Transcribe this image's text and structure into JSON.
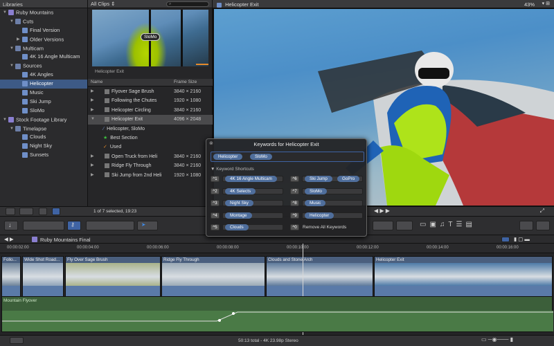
{
  "library": {
    "header": "Libraries",
    "items": [
      {
        "label": "Ruby Mountains",
        "level": 0,
        "tri": "▼",
        "icon": "library"
      },
      {
        "label": "Cuts",
        "level": 1,
        "tri": "▼",
        "icon": "event"
      },
      {
        "label": "Final Version",
        "level": 2,
        "tri": "",
        "icon": "keyword"
      },
      {
        "label": "Older Versions",
        "level": 2,
        "tri": "▶",
        "icon": "keyword"
      },
      {
        "label": "Multicam",
        "level": 1,
        "tri": "▼",
        "icon": "event"
      },
      {
        "label": "4K 16 Angle Multicam",
        "level": 2,
        "tri": "",
        "icon": "keyword"
      },
      {
        "label": "Sources",
        "level": 1,
        "tri": "▼",
        "icon": "event"
      },
      {
        "label": "4K Angles",
        "level": 2,
        "tri": "",
        "icon": "keyword"
      },
      {
        "label": "Helicopter",
        "level": 2,
        "tri": "",
        "icon": "keyword",
        "selected": true
      },
      {
        "label": "Music",
        "level": 2,
        "tri": "",
        "icon": "keyword"
      },
      {
        "label": "Ski Jump",
        "level": 2,
        "tri": "",
        "icon": "keyword"
      },
      {
        "label": "SloMo",
        "level": 2,
        "tri": "",
        "icon": "keyword"
      },
      {
        "label": "Stock Footage Library",
        "level": 0,
        "tri": "▼",
        "icon": "library"
      },
      {
        "label": "Timelapse",
        "level": 1,
        "tri": "▼",
        "icon": "event"
      },
      {
        "label": "Clouds",
        "level": 2,
        "tri": "",
        "icon": "keyword"
      },
      {
        "label": "Night Sky",
        "level": 2,
        "tri": "",
        "icon": "keyword"
      },
      {
        "label": "Sunsets",
        "level": 2,
        "tri": "",
        "icon": "keyword"
      }
    ]
  },
  "browser": {
    "filter": "All Clips ⇕",
    "search_placeholder": "",
    "filmstrip_tag": "SloMo",
    "clip_name": "Helicopter Exit",
    "col_name": "Name",
    "col_size": "Frame Size",
    "rows": [
      {
        "tri": "▶",
        "name": "Flyover Sage Brush",
        "size": "3840 × 2160"
      },
      {
        "tri": "▶",
        "name": "Following the Chutes",
        "size": "1920 × 1080"
      },
      {
        "tri": "▶",
        "name": "Helicopter Circling",
        "size": "3840 × 2160"
      },
      {
        "tri": "▼",
        "name": "Helicopter Exit",
        "size": "4096 × 2048",
        "selected": true
      },
      {
        "tri": "",
        "name": "Helicopter, SloMo",
        "size": "",
        "sub": "keyword"
      },
      {
        "tri": "",
        "name": "Best Section",
        "size": "",
        "sub": "favorite"
      },
      {
        "tri": "",
        "name": "Used",
        "size": "",
        "sub": "used"
      },
      {
        "tri": "▶",
        "name": "Open Truck from Heli",
        "size": "3840 × 2160"
      },
      {
        "tri": "▶",
        "name": "Ridge Fly Through",
        "size": "3840 × 2160"
      },
      {
        "tri": "▶",
        "name": "Ski Jump from 2nd Heli",
        "size": "1920 × 1080"
      }
    ],
    "selection_status": "1 of 7 selected, 19:23"
  },
  "viewer": {
    "title": "Helicopter Exit",
    "zoom": "43%"
  },
  "hud": {
    "title": "Keywords for Helicopter Exit",
    "active_tags": [
      "Helicopter",
      "SloMo"
    ],
    "section": "Keyword Shortcuts",
    "shortcuts_left": [
      {
        "key": "^1",
        "kw": "4K 16 Angle Multicam"
      },
      {
        "key": "^2",
        "kw": "4K Selects"
      },
      {
        "key": "^3",
        "kw": "Night Sky"
      },
      {
        "key": "^4",
        "kw": "Montage"
      },
      {
        "key": "^5",
        "kw": "Clouds"
      }
    ],
    "shortcuts_right": [
      {
        "key": "^6",
        "kw": "Ski Jump",
        "kw2": "GoPro"
      },
      {
        "key": "^7",
        "kw": "SloMo"
      },
      {
        "key": "^8",
        "kw": "Music"
      },
      {
        "key": "^9",
        "kw": "Helicopter"
      },
      {
        "key": "^0",
        "kw": "Remove All Keywords"
      }
    ]
  },
  "timeline": {
    "project": "Ruby Mountains Final",
    "timecodes": [
      "00:00:02:00",
      "00:00:04:00",
      "00:00:06:00",
      "00:00:08:00",
      "00:00:10:00",
      "00:00:12:00",
      "00:00:14:00",
      "00:00:16:00"
    ],
    "clips": [
      {
        "label": "Follo..."
      },
      {
        "label": "Wide Shot Road..."
      },
      {
        "label": "Fly Over Sage Brush"
      },
      {
        "label": "Ridge Fly Through"
      },
      {
        "label": "Clouds and Stone Arch"
      },
      {
        "label": "Helicopter Exit"
      }
    ],
    "audio_label": "Mountain Flyover"
  },
  "status": {
    "text": "50:13 total - 4K 23.98p Stereo"
  },
  "colors": {
    "selection": "#3d5a86",
    "keyword_pill": "#4f6e9c",
    "audio": "#3c5f3a",
    "video_clip": "#556c88"
  }
}
